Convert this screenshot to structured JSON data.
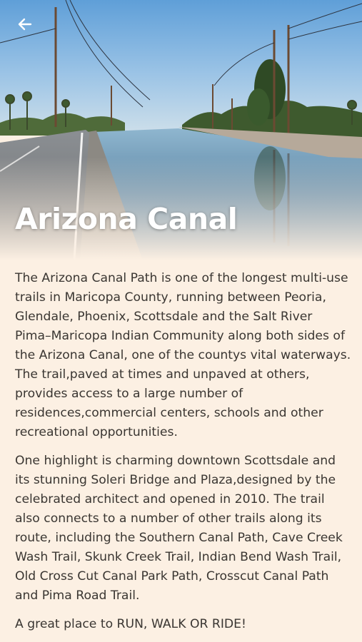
{
  "header": {
    "back_icon": "arrow-left-icon",
    "title": "Arizona Canal"
  },
  "hero_image": {
    "subject": "canal-with-path-photo"
  },
  "body": {
    "paragraphs": [
      "The Arizona Canal Path is one of the longest multi-use trails in Maricopa County, running between Peoria, Glendale, Phoenix, Scottsdale and the Salt River Pima–Maricopa Indian Community along both sides of the Arizona Canal, one of the countys vital waterways. The trail,paved at times and unpaved at others, provides access to a large number of residences,commercial centers, schools and other recreational opportunities.",
      "One highlight is charming downtown Scottsdale and its stunning Soleri Bridge and Plaza,designed by the celebrated architect and opened in 2010. The trail also connects to a number of other trails along its route, including the Southern Canal Path, Cave Creek Wash Trail, Skunk Creek Trail, Indian Bend Wash Trail, Old Cross Cut Canal Park Path, Crosscut Canal Path and Pima Road Trail.",
      "A great place to RUN, WALK OR RIDE!"
    ]
  },
  "colors": {
    "background": "#fcf0e3",
    "text": "#3a3632",
    "title": "#ffffff"
  }
}
